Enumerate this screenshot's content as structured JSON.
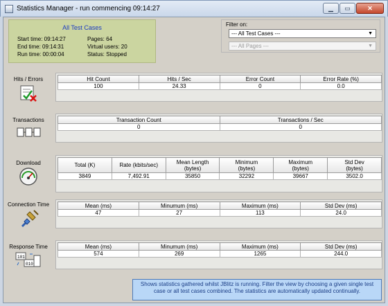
{
  "window": {
    "title": "Statistics Manager - run commencing 09:14:27",
    "buttons": {
      "minimize": "▁",
      "maximize": "▭",
      "close": "✕"
    }
  },
  "summary": {
    "title": "All Test Cases",
    "start_time": "Start time:  09:14:27",
    "end_time": "End time:  09:14:31",
    "run_time": "Run time:  00:00:04",
    "pages": "Pages:  64",
    "virtual_users": "Virtual users:  20",
    "status": "Status:  Stopped"
  },
  "filter": {
    "label": "Filter on:",
    "test_case_selected": "--- All Test Cases ---",
    "pages_selected": "--- All Pages ---"
  },
  "sections": {
    "hits": {
      "label": "Hits / Errors",
      "icon": "hits-errors-icon",
      "headers": [
        "Hit Count",
        "Hits / Sec",
        "Error Count",
        "Error Rate (%)"
      ],
      "values": [
        "100",
        "24.33",
        "0",
        "0.0"
      ]
    },
    "transactions": {
      "label": "Transactions",
      "icon": "transactions-icon",
      "headers": [
        "Transaction Count",
        "Transactions / Sec"
      ],
      "values": [
        "0",
        "0"
      ]
    },
    "download": {
      "label": "Download",
      "icon": "gauge-icon",
      "headers": [
        "Total (K)",
        "Rate (kbits/sec)",
        "Mean Length (bytes)",
        "Minimum (bytes)",
        "Maximum (bytes)",
        "Std Dev (bytes)"
      ],
      "header_lines": [
        [
          "Total (K)"
        ],
        [
          "Rate (kbits/sec)"
        ],
        [
          "Mean Length",
          "(bytes)"
        ],
        [
          "Minimum",
          "(bytes)"
        ],
        [
          "Maximum",
          "(bytes)"
        ],
        [
          "Std Dev",
          "(bytes)"
        ]
      ],
      "values": [
        "3849",
        "7,492.91",
        "35850",
        "32292",
        "39667",
        "3502.0"
      ]
    },
    "connection": {
      "label": "Connection Time",
      "icon": "connection-plug-icon",
      "headers": [
        "Mean (ms)",
        "Minumum (ms)",
        "Maximum (ms)",
        "Std Dev (ms)"
      ],
      "values": [
        "47",
        "27",
        "113",
        "24.0"
      ]
    },
    "response": {
      "label": "Response Time",
      "icon": "response-data-icon",
      "headers": [
        "Mean (ms)",
        "Minumum (ms)",
        "Maximum (ms)",
        "Std Dev (ms)"
      ],
      "values": [
        "574",
        "269",
        "1265",
        "244.0"
      ]
    }
  },
  "info": "Shows statistics gathered whilst JBlitz is running. Filter the view by choosing a given single test case or all test cases combined. The statistics are automatically updated continually."
}
